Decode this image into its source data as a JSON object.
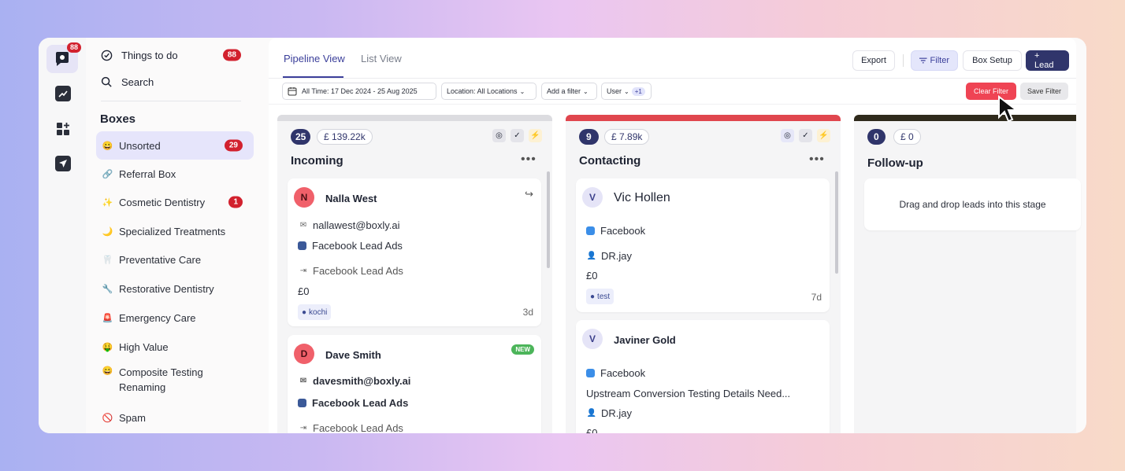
{
  "rail": {
    "logo_badge": "88"
  },
  "sidebar": {
    "things_to_do": {
      "label": "Things to do",
      "count": "88"
    },
    "search": {
      "label": "Search"
    },
    "boxes_heading": "Boxes",
    "items": [
      {
        "icon": "😀",
        "label": "Unsorted",
        "count": "29"
      },
      {
        "icon": "🔗",
        "label": "Referral Box",
        "count": ""
      },
      {
        "icon": "✨",
        "label": "Cosmetic Dentistry",
        "count": "1"
      },
      {
        "icon": "🌙",
        "label": "Specialized Treatments",
        "count": ""
      },
      {
        "icon": "🦷",
        "label": "Preventative Care",
        "count": ""
      },
      {
        "icon": "🔧",
        "label": "Restorative Dentistry",
        "count": ""
      },
      {
        "icon": "🚨",
        "label": "Emergency Care",
        "count": ""
      },
      {
        "icon": "🤑",
        "label": "High Value",
        "count": ""
      },
      {
        "icon": "😄",
        "label": "Composite Testing Renaming",
        "count": ""
      },
      {
        "icon": "🚫",
        "label": "Spam",
        "count": ""
      }
    ]
  },
  "tabs": {
    "pipeline": "Pipeline View",
    "list": "List View"
  },
  "toolbar": {
    "export": "Export",
    "filter": "Filter",
    "box_setup": "Box Setup",
    "lead": "+ Lead"
  },
  "filters": {
    "date": "All Time: 17 Dec 2024 - 25 Aug 2025",
    "location": "Location: All Locations",
    "add_filter": "Add a filter",
    "user": "User",
    "user_extra": "+1",
    "clear": "Clear Filter",
    "save": "Save Filter"
  },
  "columns": [
    {
      "count": "25",
      "amount": "£ 139.22k",
      "title": "Incoming",
      "menu": "•••",
      "bar_color": "#dcdce0",
      "cards": [
        {
          "initial": "N",
          "name": "Nalla West",
          "email": "nallawest@boxly.ai",
          "source": "Facebook Lead Ads",
          "via": "Facebook Lead Ads",
          "value": "£0",
          "tag": "kochi",
          "age": "3d"
        },
        {
          "initial": "D",
          "name": "Dave Smith",
          "badge": "NEW",
          "email": "davesmith@boxly.ai",
          "source": "Facebook Lead Ads",
          "via": "Facebook Lead Ads"
        }
      ]
    },
    {
      "count": "9",
      "amount": "£ 7.89k",
      "title": "Contacting",
      "menu": "•••",
      "bar_color": "#e0464e",
      "cards": [
        {
          "initial": "V",
          "name": "Vic Hollen",
          "source": "Facebook",
          "owner": "DR.jay",
          "value": "£0",
          "tag": "test",
          "age": "7d"
        },
        {
          "initial": "V",
          "name": "Javiner Gold",
          "source": "Facebook",
          "note": "Upstream Conversion Testing Details Need...",
          "owner": "DR.jay",
          "value": "£0"
        }
      ]
    },
    {
      "count": "0",
      "amount": "£ 0",
      "title": "Follow-up",
      "bar_color": "#2f2a1c",
      "empty_text": "Drag and drop leads into this stage"
    }
  ]
}
